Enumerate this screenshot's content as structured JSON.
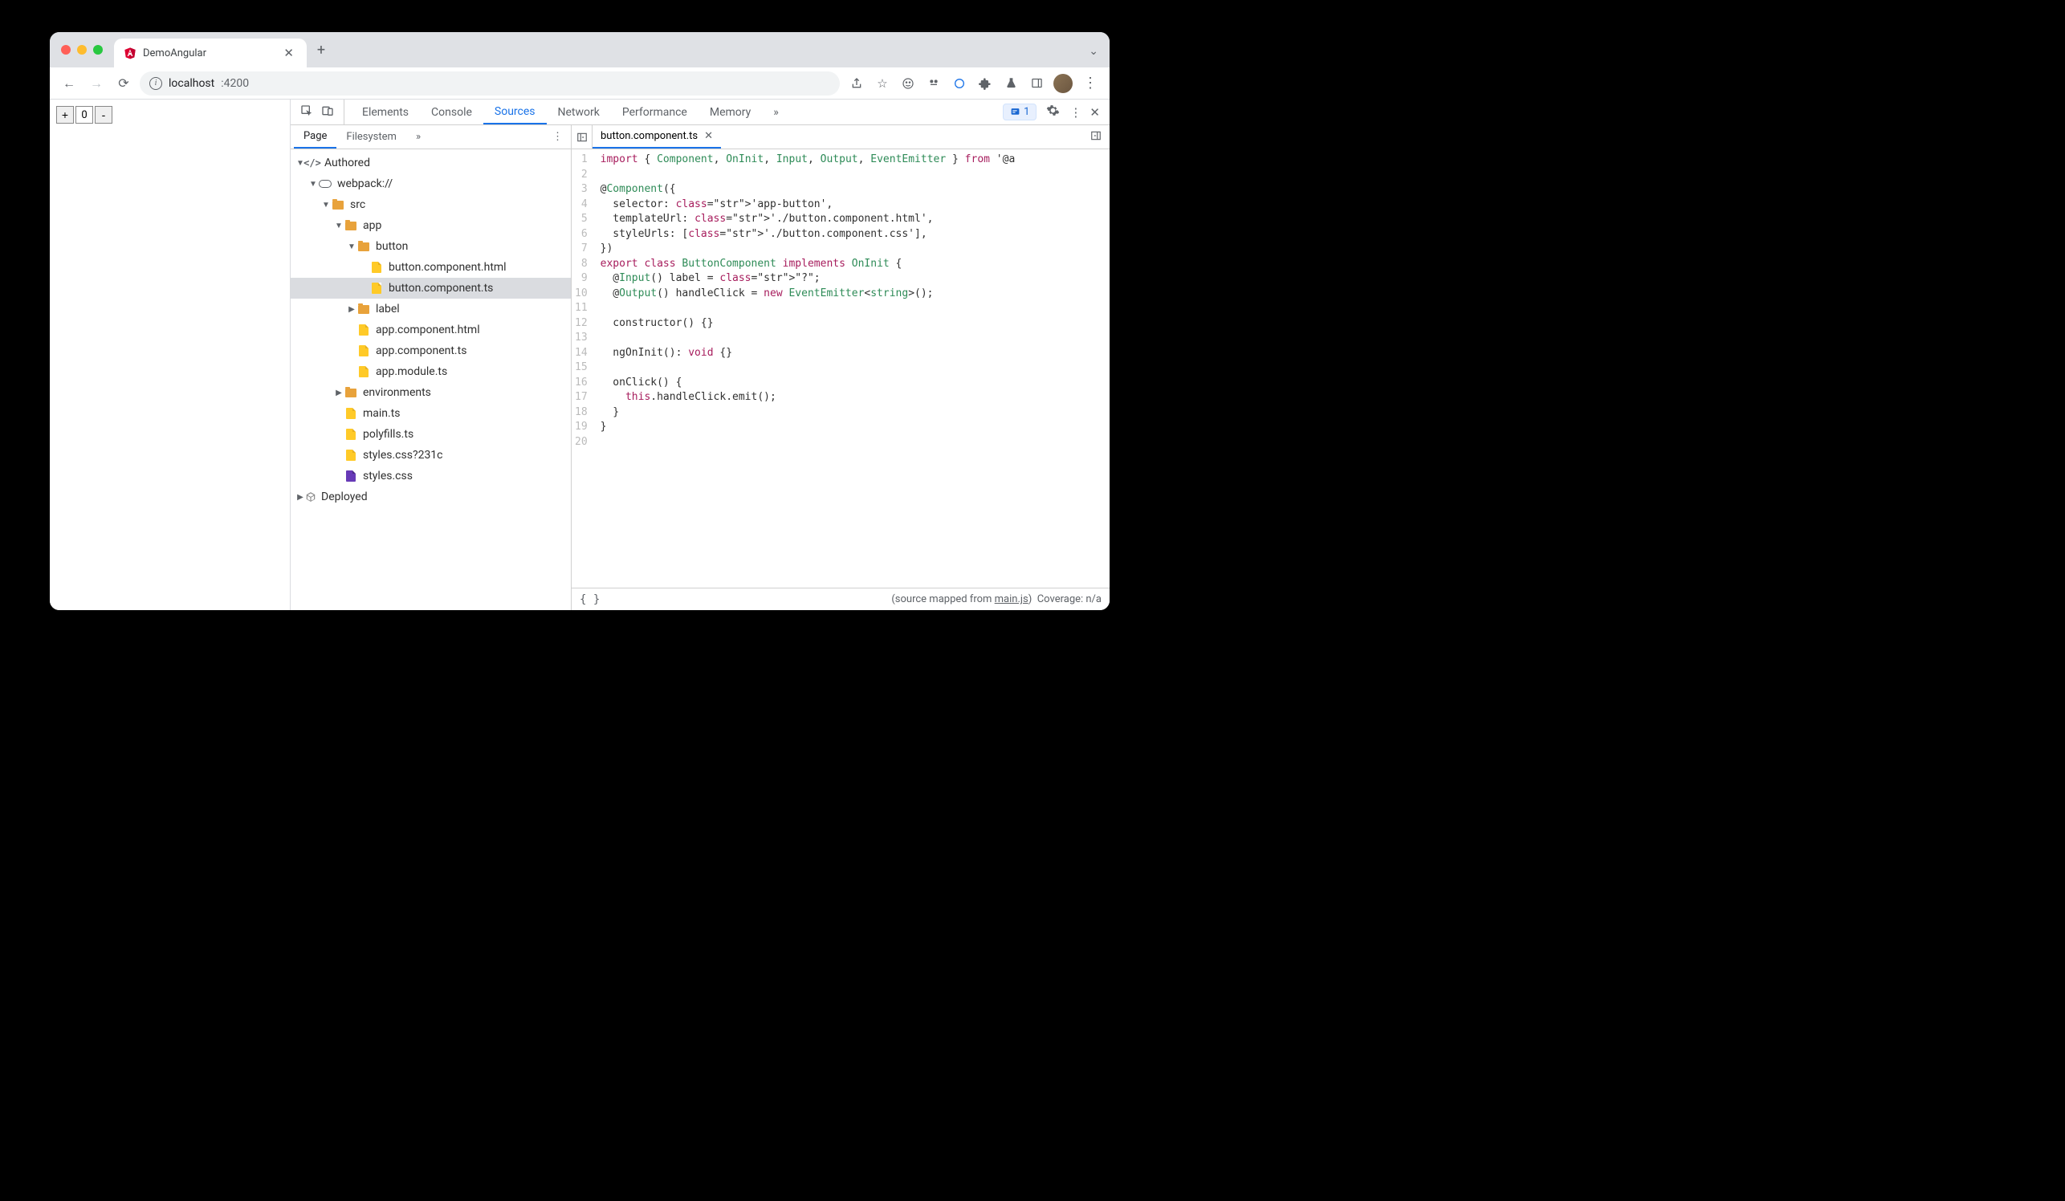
{
  "browser": {
    "tab_title": "DemoAngular",
    "url_host": "localhost",
    "url_port": ":4200"
  },
  "page": {
    "counter_value": "0"
  },
  "devtools": {
    "tabs": [
      "Elements",
      "Console",
      "Sources",
      "Network",
      "Performance",
      "Memory"
    ],
    "active_tab": "Sources",
    "issues_count": "1",
    "sources": {
      "nav_tabs": [
        "Page",
        "Filesystem"
      ],
      "active_nav": "Page",
      "tree": {
        "authored": "Authored",
        "webpack": "webpack://",
        "src": "src",
        "app": "app",
        "button": "button",
        "button_html": "button.component.html",
        "button_ts": "button.component.ts",
        "label": "label",
        "app_html": "app.component.html",
        "app_ts": "app.component.ts",
        "app_module": "app.module.ts",
        "environments": "environments",
        "main_ts": "main.ts",
        "polyfills": "polyfills.ts",
        "styles_q": "styles.css?231c",
        "styles": "styles.css",
        "deployed": "Deployed"
      },
      "open_file": "button.component.ts",
      "code_lines": [
        "import { Component, OnInit, Input, Output, EventEmitter } from '@a",
        "",
        "@Component({",
        "  selector: 'app-button',",
        "  templateUrl: './button.component.html',",
        "  styleUrls: ['./button.component.css'],",
        "})",
        "export class ButtonComponent implements OnInit {",
        "  @Input() label = \"?\";",
        "  @Output() handleClick = new EventEmitter<string>();",
        "",
        "  constructor() {}",
        "",
        "  ngOnInit(): void {}",
        "",
        "  onClick() {",
        "    this.handleClick.emit();",
        "  }",
        "}",
        ""
      ],
      "footer_mapped_prefix": "(source mapped from ",
      "footer_mapped_link": "main.js",
      "footer_mapped_suffix": ")",
      "footer_coverage": "Coverage: n/a"
    }
  }
}
